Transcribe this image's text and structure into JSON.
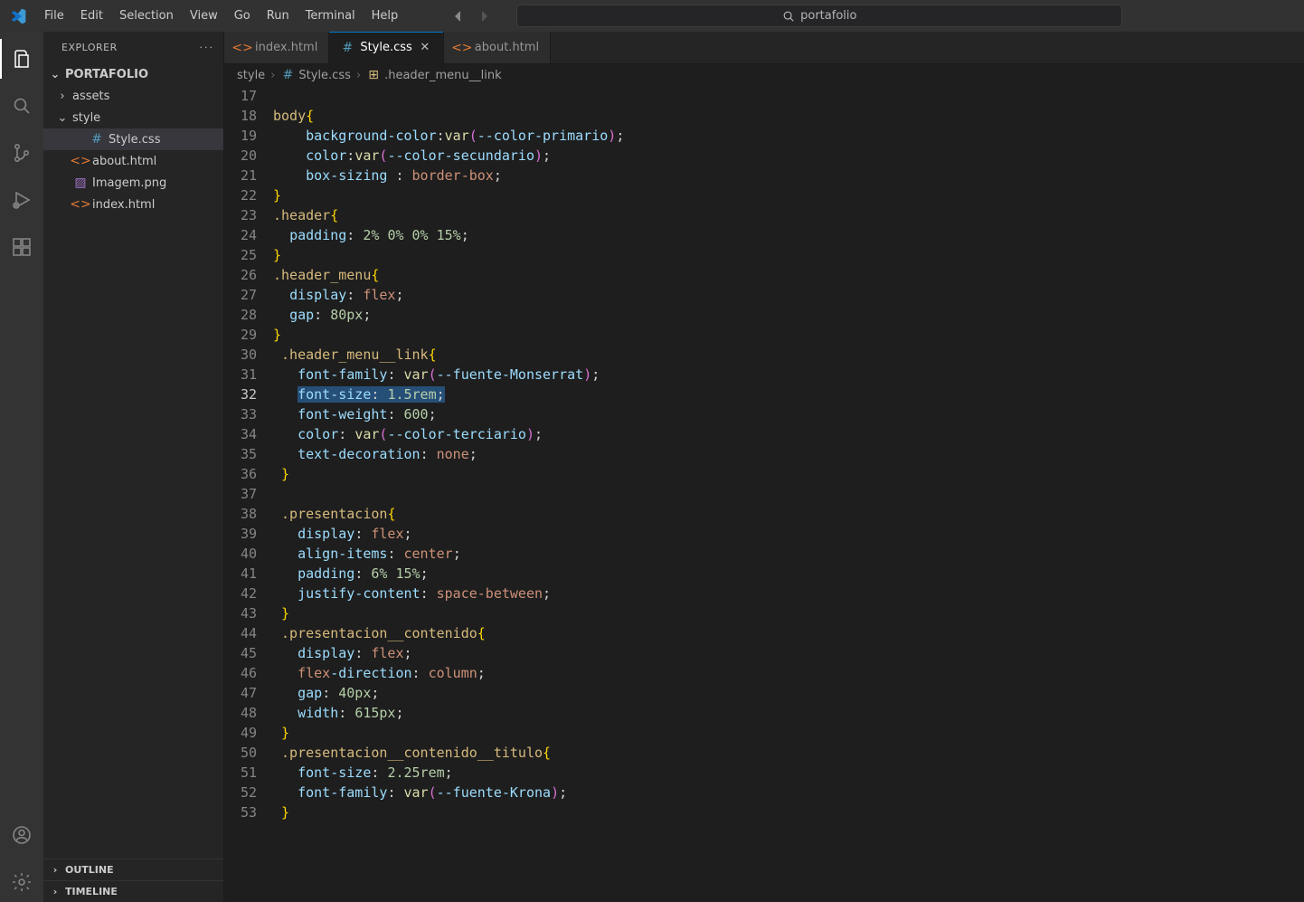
{
  "menu": {
    "items": [
      "File",
      "Edit",
      "Selection",
      "View",
      "Go",
      "Run",
      "Terminal",
      "Help"
    ]
  },
  "search": {
    "placeholder": "portafolio"
  },
  "activity": {
    "items": [
      "explorer",
      "search",
      "source-control",
      "run-debug",
      "extensions"
    ],
    "active": 0,
    "bottom": [
      "accounts",
      "settings"
    ]
  },
  "explorer": {
    "title": "EXPLORER",
    "root": "PORTAFOLIO",
    "tree": [
      {
        "kind": "folder",
        "name": "assets",
        "expanded": false,
        "depth": 1
      },
      {
        "kind": "folder",
        "name": "style",
        "expanded": true,
        "depth": 1
      },
      {
        "kind": "file",
        "name": "Style.css",
        "icon": "css",
        "depth": 2,
        "selected": true
      },
      {
        "kind": "file",
        "name": "about.html",
        "icon": "html",
        "depth": 1
      },
      {
        "kind": "file",
        "name": "Imagem.png",
        "icon": "img",
        "depth": 1
      },
      {
        "kind": "file",
        "name": "index.html",
        "icon": "html",
        "depth": 1
      }
    ],
    "sections": [
      "OUTLINE",
      "TIMELINE"
    ]
  },
  "tabs": [
    {
      "label": "index.html",
      "icon": "html",
      "active": false
    },
    {
      "label": "Style.css",
      "icon": "css",
      "active": true,
      "close": true
    },
    {
      "label": "about.html",
      "icon": "html",
      "active": false
    }
  ],
  "breadcrumb": [
    {
      "label": "style",
      "icon": null
    },
    {
      "label": "Style.css",
      "icon": "css"
    },
    {
      "label": ".header_menu__link",
      "icon": "brace"
    }
  ],
  "editor": {
    "firstLine": 17,
    "currentLine": 32,
    "selectedText": "font-size: 1.5rem;",
    "lines": [
      "",
      "body{",
      "    background-color:var(--color-primario);",
      "    color:var(--color-secundario);",
      "    box-sizing : border-box;",
      "}",
      ".header{",
      "  padding: 2% 0% 0% 15%;",
      "}",
      ".header_menu{",
      "  display: flex;",
      "  gap: 80px;",
      "}",
      " .header_menu__link{",
      "   font-family: var(--fuente-Monserrat);",
      "   font-size: 1.5rem;",
      "   font-weight: 600;",
      "   color: var(--color-terciario);",
      "   text-decoration: none;",
      " }",
      "",
      " .presentacion{",
      "   display: flex;",
      "   align-items: center;",
      "   padding: 6% 15%;",
      "   justify-content: space-between;",
      " }",
      " .presentacion__contenido{",
      "   display: flex;",
      "   flex-direction: column;",
      "   gap: 40px;",
      "   width: 615px;",
      " }",
      " .presentacion__contenido__titulo{",
      "   font-size: 2.25rem;",
      "   font-family: var(--fuente-Krona);",
      " }"
    ]
  }
}
